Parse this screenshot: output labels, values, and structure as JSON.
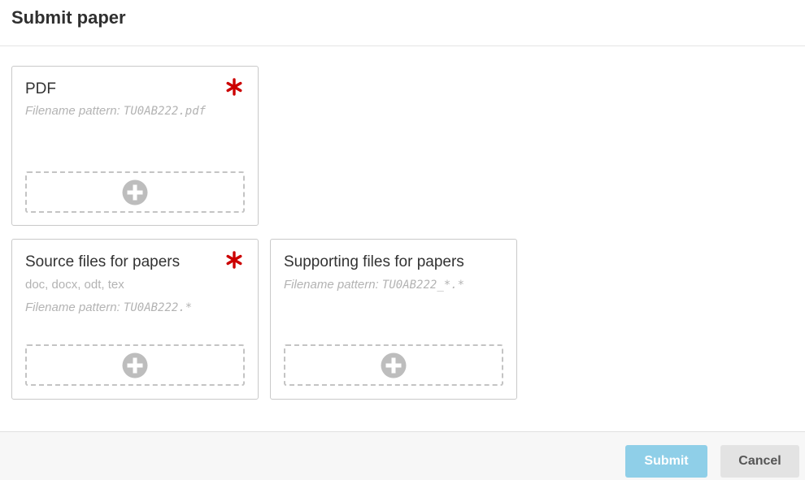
{
  "dialog": {
    "title": "Submit paper"
  },
  "cards": {
    "pdf": {
      "title": "PDF",
      "pattern_prefix": "Filename pattern: ",
      "pattern": "TU0AB222.pdf"
    },
    "source": {
      "title": "Source files for papers",
      "formats": "doc, docx, odt, tex",
      "pattern_prefix": "Filename pattern: ",
      "pattern": "TU0AB222.*"
    },
    "supporting": {
      "title": "Supporting files for papers",
      "pattern_prefix": "Filename pattern: ",
      "pattern": "TU0AB222_*.*"
    }
  },
  "footer": {
    "submit_label": "Submit",
    "cancel_label": "Cancel"
  },
  "colors": {
    "required": "#cc0000",
    "plus_icon": "#bdbdbd",
    "submit_bg": "#8fcfe8",
    "cancel_bg": "#e3e3e3"
  }
}
